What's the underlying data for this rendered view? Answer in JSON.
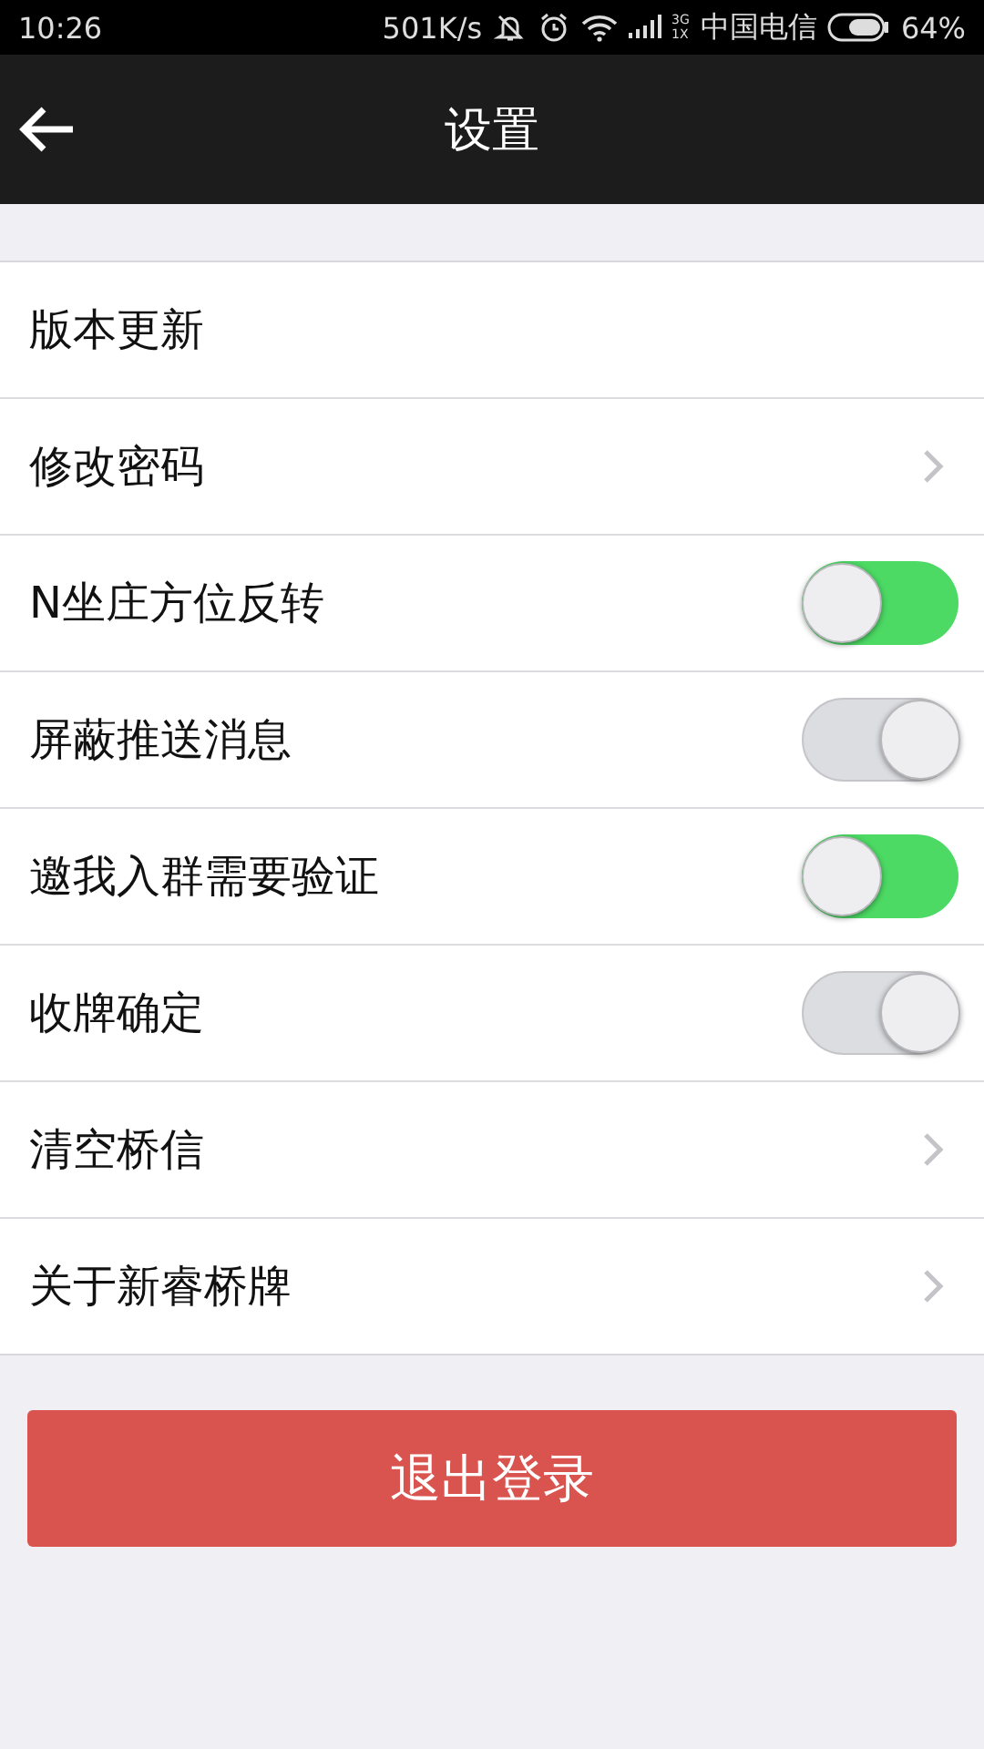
{
  "status_bar": {
    "time": "10:26",
    "speed": "501K/s",
    "network_top": "3G",
    "network_bottom": "1X",
    "carrier": "中国电信",
    "battery": "64%"
  },
  "header": {
    "title": "设置"
  },
  "items": [
    {
      "label": "版本更新",
      "kind": "plain"
    },
    {
      "label": "修改密码",
      "kind": "link"
    },
    {
      "label": "N坐庄方位反转",
      "kind": "toggle",
      "on": true
    },
    {
      "label": "屏蔽推送消息",
      "kind": "toggle",
      "on": false
    },
    {
      "label": "邀我入群需要验证",
      "kind": "toggle",
      "on": true
    },
    {
      "label": "收牌确定",
      "kind": "toggle",
      "on": false
    },
    {
      "label": "清空桥信",
      "kind": "link"
    },
    {
      "label": "关于新睿桥牌",
      "kind": "link"
    }
  ],
  "logout_button": "退出登录"
}
